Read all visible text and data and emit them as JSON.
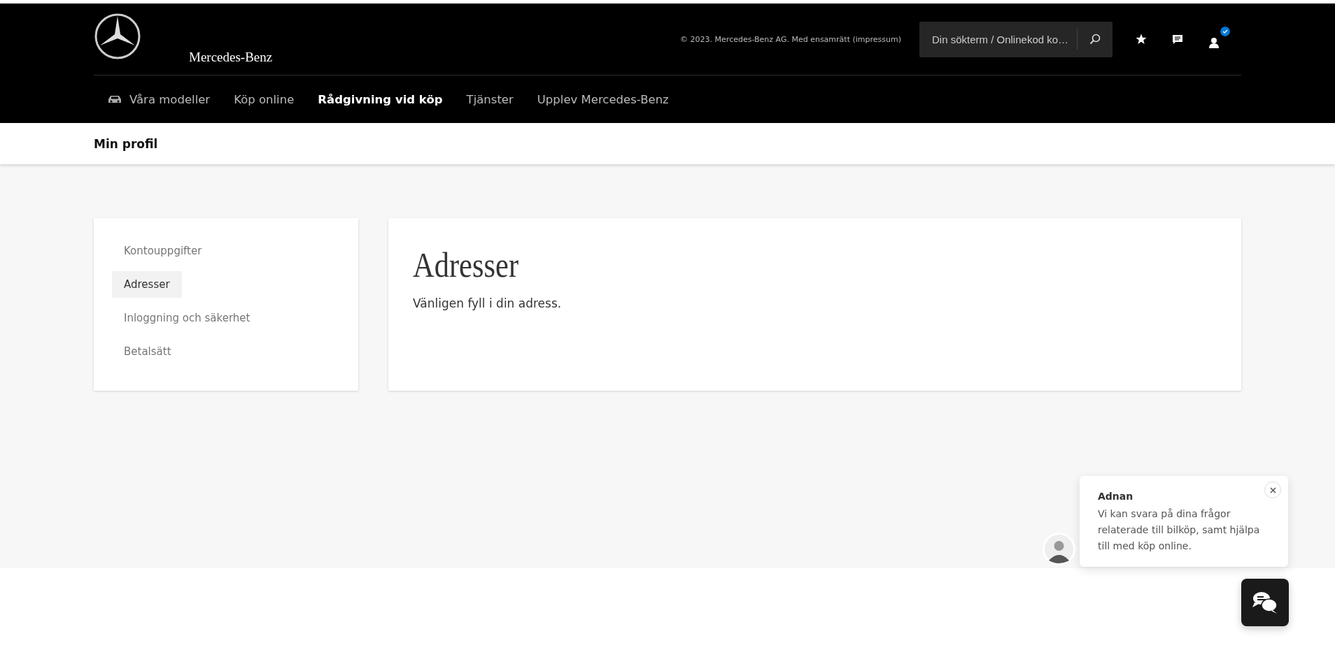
{
  "header": {
    "brand": "Mercedes-Benz",
    "copyright": "© 2023. Mercedes-Benz AG. Med ensamrätt (impressum)",
    "search": {
      "placeholder": "Din sökterm / Onlinekod ko…"
    },
    "account_verified": true
  },
  "nav": [
    {
      "label": "Våra modeller",
      "selected": false,
      "kind": "models"
    },
    {
      "label": "Köp online",
      "selected": false,
      "kind": "link"
    },
    {
      "label": "Rådgivning vid köp",
      "selected": true,
      "kind": "link"
    },
    {
      "label": "Tjänster",
      "selected": false,
      "kind": "link"
    },
    {
      "label": "Upplev Mercedes-Benz",
      "selected": false,
      "kind": "link"
    }
  ],
  "page_title": "Min profil",
  "sidebar": {
    "items": [
      {
        "label": "Kontouppgifter",
        "selected": false
      },
      {
        "label": "Adresser",
        "selected": true
      },
      {
        "label": "Inloggning och säkerhet",
        "selected": false
      },
      {
        "label": "Betalsätt",
        "selected": false
      }
    ]
  },
  "main": {
    "heading": "Adresser",
    "text": "Vänligen fyll i din adress."
  },
  "chat": {
    "agent": "Adnan",
    "message": "Vi kan svara på dina frågor relaterade till bilköp, samt hjälpa till med köp online."
  }
}
